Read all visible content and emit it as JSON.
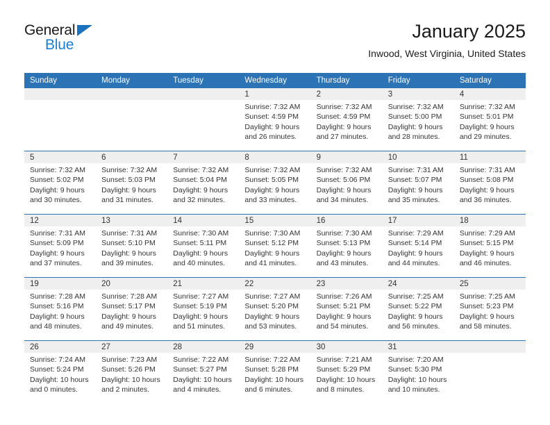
{
  "brand": {
    "name_top": "General",
    "name_bottom": "Blue",
    "accent_color": "#1c72bd"
  },
  "header": {
    "title": "January 2025",
    "subtitle": "Inwood, West Virginia, United States"
  },
  "theme": {
    "header_blue": "#2c73b5",
    "daynum_band": "#efefef",
    "text": "#333333"
  },
  "calendar": {
    "weekday_headers": [
      "Sunday",
      "Monday",
      "Tuesday",
      "Wednesday",
      "Thursday",
      "Friday",
      "Saturday"
    ],
    "weeks": [
      [
        {
          "day": "",
          "empty": true
        },
        {
          "day": "",
          "empty": true
        },
        {
          "day": "",
          "empty": true
        },
        {
          "day": "1",
          "sunrise": "Sunrise: 7:32 AM",
          "sunset": "Sunset: 4:59 PM",
          "daylight1": "Daylight: 9 hours",
          "daylight2": "and 26 minutes."
        },
        {
          "day": "2",
          "sunrise": "Sunrise: 7:32 AM",
          "sunset": "Sunset: 4:59 PM",
          "daylight1": "Daylight: 9 hours",
          "daylight2": "and 27 minutes."
        },
        {
          "day": "3",
          "sunrise": "Sunrise: 7:32 AM",
          "sunset": "Sunset: 5:00 PM",
          "daylight1": "Daylight: 9 hours",
          "daylight2": "and 28 minutes."
        },
        {
          "day": "4",
          "sunrise": "Sunrise: 7:32 AM",
          "sunset": "Sunset: 5:01 PM",
          "daylight1": "Daylight: 9 hours",
          "daylight2": "and 29 minutes."
        }
      ],
      [
        {
          "day": "5",
          "sunrise": "Sunrise: 7:32 AM",
          "sunset": "Sunset: 5:02 PM",
          "daylight1": "Daylight: 9 hours",
          "daylight2": "and 30 minutes."
        },
        {
          "day": "6",
          "sunrise": "Sunrise: 7:32 AM",
          "sunset": "Sunset: 5:03 PM",
          "daylight1": "Daylight: 9 hours",
          "daylight2": "and 31 minutes."
        },
        {
          "day": "7",
          "sunrise": "Sunrise: 7:32 AM",
          "sunset": "Sunset: 5:04 PM",
          "daylight1": "Daylight: 9 hours",
          "daylight2": "and 32 minutes."
        },
        {
          "day": "8",
          "sunrise": "Sunrise: 7:32 AM",
          "sunset": "Sunset: 5:05 PM",
          "daylight1": "Daylight: 9 hours",
          "daylight2": "and 33 minutes."
        },
        {
          "day": "9",
          "sunrise": "Sunrise: 7:32 AM",
          "sunset": "Sunset: 5:06 PM",
          "daylight1": "Daylight: 9 hours",
          "daylight2": "and 34 minutes."
        },
        {
          "day": "10",
          "sunrise": "Sunrise: 7:31 AM",
          "sunset": "Sunset: 5:07 PM",
          "daylight1": "Daylight: 9 hours",
          "daylight2": "and 35 minutes."
        },
        {
          "day": "11",
          "sunrise": "Sunrise: 7:31 AM",
          "sunset": "Sunset: 5:08 PM",
          "daylight1": "Daylight: 9 hours",
          "daylight2": "and 36 minutes."
        }
      ],
      [
        {
          "day": "12",
          "sunrise": "Sunrise: 7:31 AM",
          "sunset": "Sunset: 5:09 PM",
          "daylight1": "Daylight: 9 hours",
          "daylight2": "and 37 minutes."
        },
        {
          "day": "13",
          "sunrise": "Sunrise: 7:31 AM",
          "sunset": "Sunset: 5:10 PM",
          "daylight1": "Daylight: 9 hours",
          "daylight2": "and 39 minutes."
        },
        {
          "day": "14",
          "sunrise": "Sunrise: 7:30 AM",
          "sunset": "Sunset: 5:11 PM",
          "daylight1": "Daylight: 9 hours",
          "daylight2": "and 40 minutes."
        },
        {
          "day": "15",
          "sunrise": "Sunrise: 7:30 AM",
          "sunset": "Sunset: 5:12 PM",
          "daylight1": "Daylight: 9 hours",
          "daylight2": "and 41 minutes."
        },
        {
          "day": "16",
          "sunrise": "Sunrise: 7:30 AM",
          "sunset": "Sunset: 5:13 PM",
          "daylight1": "Daylight: 9 hours",
          "daylight2": "and 43 minutes."
        },
        {
          "day": "17",
          "sunrise": "Sunrise: 7:29 AM",
          "sunset": "Sunset: 5:14 PM",
          "daylight1": "Daylight: 9 hours",
          "daylight2": "and 44 minutes."
        },
        {
          "day": "18",
          "sunrise": "Sunrise: 7:29 AM",
          "sunset": "Sunset: 5:15 PM",
          "daylight1": "Daylight: 9 hours",
          "daylight2": "and 46 minutes."
        }
      ],
      [
        {
          "day": "19",
          "sunrise": "Sunrise: 7:28 AM",
          "sunset": "Sunset: 5:16 PM",
          "daylight1": "Daylight: 9 hours",
          "daylight2": "and 48 minutes."
        },
        {
          "day": "20",
          "sunrise": "Sunrise: 7:28 AM",
          "sunset": "Sunset: 5:17 PM",
          "daylight1": "Daylight: 9 hours",
          "daylight2": "and 49 minutes."
        },
        {
          "day": "21",
          "sunrise": "Sunrise: 7:27 AM",
          "sunset": "Sunset: 5:19 PM",
          "daylight1": "Daylight: 9 hours",
          "daylight2": "and 51 minutes."
        },
        {
          "day": "22",
          "sunrise": "Sunrise: 7:27 AM",
          "sunset": "Sunset: 5:20 PM",
          "daylight1": "Daylight: 9 hours",
          "daylight2": "and 53 minutes."
        },
        {
          "day": "23",
          "sunrise": "Sunrise: 7:26 AM",
          "sunset": "Sunset: 5:21 PM",
          "daylight1": "Daylight: 9 hours",
          "daylight2": "and 54 minutes."
        },
        {
          "day": "24",
          "sunrise": "Sunrise: 7:25 AM",
          "sunset": "Sunset: 5:22 PM",
          "daylight1": "Daylight: 9 hours",
          "daylight2": "and 56 minutes."
        },
        {
          "day": "25",
          "sunrise": "Sunrise: 7:25 AM",
          "sunset": "Sunset: 5:23 PM",
          "daylight1": "Daylight: 9 hours",
          "daylight2": "and 58 minutes."
        }
      ],
      [
        {
          "day": "26",
          "sunrise": "Sunrise: 7:24 AM",
          "sunset": "Sunset: 5:24 PM",
          "daylight1": "Daylight: 10 hours",
          "daylight2": "and 0 minutes."
        },
        {
          "day": "27",
          "sunrise": "Sunrise: 7:23 AM",
          "sunset": "Sunset: 5:26 PM",
          "daylight1": "Daylight: 10 hours",
          "daylight2": "and 2 minutes."
        },
        {
          "day": "28",
          "sunrise": "Sunrise: 7:22 AM",
          "sunset": "Sunset: 5:27 PM",
          "daylight1": "Daylight: 10 hours",
          "daylight2": "and 4 minutes."
        },
        {
          "day": "29",
          "sunrise": "Sunrise: 7:22 AM",
          "sunset": "Sunset: 5:28 PM",
          "daylight1": "Daylight: 10 hours",
          "daylight2": "and 6 minutes."
        },
        {
          "day": "30",
          "sunrise": "Sunrise: 7:21 AM",
          "sunset": "Sunset: 5:29 PM",
          "daylight1": "Daylight: 10 hours",
          "daylight2": "and 8 minutes."
        },
        {
          "day": "31",
          "sunrise": "Sunrise: 7:20 AM",
          "sunset": "Sunset: 5:30 PM",
          "daylight1": "Daylight: 10 hours",
          "daylight2": "and 10 minutes."
        },
        {
          "day": "",
          "empty": true
        }
      ]
    ]
  }
}
